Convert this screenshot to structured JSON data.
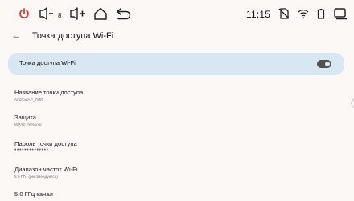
{
  "status_bar": {
    "volume_level": "8",
    "time": "11:15",
    "accent_color": "#e53935",
    "icons": [
      "power-icon",
      "volume-down-icon",
      "volume-up-icon",
      "home-icon",
      "back-icon",
      "no-sim-icon",
      "wifi-icon",
      "battery-icon",
      "recent-apps-icon"
    ]
  },
  "header": {
    "title": "Точка доступа Wi-Fi"
  },
  "toggle": {
    "label": "Точка доступа Wi-Fi",
    "state": "off"
  },
  "rows": [
    {
      "title": "Название точки доступа",
      "subtitle": "AndroidAP_7599"
    },
    {
      "title": "Защита",
      "subtitle": "WPA2-Personal"
    },
    {
      "title": "Пароль точки доступа",
      "subtitle": "••••••••••••••"
    },
    {
      "title": "Диапазон частот Wi-Fi",
      "subtitle": "5,0 ГГц (рекомендуется)"
    },
    {
      "title": "5,0 ГГц канал",
      "subtitle": ""
    }
  ]
}
